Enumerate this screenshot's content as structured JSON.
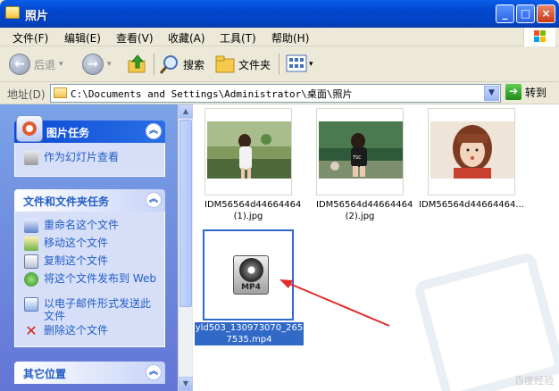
{
  "window": {
    "title": "照片",
    "buttons": [
      "_",
      "□",
      "×"
    ]
  },
  "menu": [
    "文件(F)",
    "编辑(E)",
    "查看(V)",
    "收藏(A)",
    "工具(T)",
    "帮助(H)"
  ],
  "toolbar": {
    "back": "后退",
    "forward": "",
    "search": "搜索",
    "folders": "文件夹"
  },
  "address": {
    "label": "地址(D)",
    "path": "C:\\Documents and Settings\\Administrator\\桌面\\照片",
    "go": "转到"
  },
  "left_pane": {
    "picture_tasks": {
      "title": "图片任务",
      "items": [
        "作为幻灯片查看"
      ]
    },
    "file_tasks": {
      "title": "文件和文件夹任务",
      "items": [
        "重命名这个文件",
        "移动这个文件",
        "复制这个文件",
        "将这个文件发布到 Web",
        "以电子邮件形式发送此文件",
        "删除这个文件"
      ]
    },
    "other_places": {
      "title": "其它位置"
    }
  },
  "files": [
    {
      "name_line1": "IDM56564d44664464",
      "name_line2": "(1).jpg"
    },
    {
      "name_line1": "IDM56564d44664464",
      "name_line2": "(2).jpg"
    },
    {
      "name_line1": "IDM56564d44664464...",
      "name_line2": ""
    },
    {
      "name_line1": "yld503_130973070_265",
      "name_line2": "7535.mp4",
      "icon_label": "MP4"
    }
  ],
  "watermark": "百度经验"
}
